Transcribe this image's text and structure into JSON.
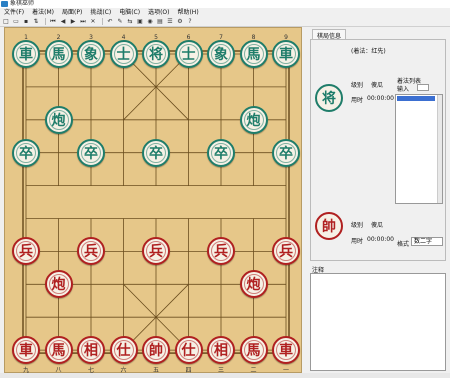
{
  "window": {
    "title": "象棋巫师"
  },
  "menu": [
    "文件(F)",
    "着法(M)",
    "局面(P)",
    "挑战(C)",
    "电脑(C)",
    "选项(O)",
    "帮助(H)"
  ],
  "toolbar_icons": [
    "new-file-icon",
    "open-file-icon",
    "save-file-icon",
    "flip-icon",
    "first-move-icon",
    "prev-move-icon",
    "next-move-icon",
    "last-move-icon",
    "delete-icon",
    "undo-icon",
    "edit-icon",
    "move-icon",
    "computer-icon",
    "analyze-icon",
    "book-icon",
    "options-icon",
    "settings-icon",
    "help-icon"
  ],
  "board": {
    "top_coords": [
      "1",
      "2",
      "3",
      "4",
      "5",
      "6",
      "7",
      "8",
      "9"
    ],
    "bottom_coords": [
      "九",
      "八",
      "七",
      "六",
      "五",
      "四",
      "三",
      "二",
      "一"
    ],
    "colors": {
      "board": "#e6c789",
      "line": "#6b4e1f",
      "black": "#1f7d6a",
      "red": "#b02020"
    },
    "pieces": [
      {
        "side": "black",
        "char": "車",
        "col": 0,
        "row": 0
      },
      {
        "side": "black",
        "char": "馬",
        "col": 1,
        "row": 0
      },
      {
        "side": "black",
        "char": "象",
        "col": 2,
        "row": 0
      },
      {
        "side": "black",
        "char": "士",
        "col": 3,
        "row": 0
      },
      {
        "side": "black",
        "char": "将",
        "col": 4,
        "row": 0
      },
      {
        "side": "black",
        "char": "士",
        "col": 5,
        "row": 0
      },
      {
        "side": "black",
        "char": "象",
        "col": 6,
        "row": 0
      },
      {
        "side": "black",
        "char": "馬",
        "col": 7,
        "row": 0
      },
      {
        "side": "black",
        "char": "車",
        "col": 8,
        "row": 0
      },
      {
        "side": "black",
        "char": "炮",
        "col": 1,
        "row": 2
      },
      {
        "side": "black",
        "char": "炮",
        "col": 7,
        "row": 2
      },
      {
        "side": "black",
        "char": "卒",
        "col": 0,
        "row": 3
      },
      {
        "side": "black",
        "char": "卒",
        "col": 2,
        "row": 3
      },
      {
        "side": "black",
        "char": "卒",
        "col": 4,
        "row": 3
      },
      {
        "side": "black",
        "char": "卒",
        "col": 6,
        "row": 3
      },
      {
        "side": "black",
        "char": "卒",
        "col": 8,
        "row": 3
      },
      {
        "side": "red",
        "char": "兵",
        "col": 0,
        "row": 6
      },
      {
        "side": "red",
        "char": "兵",
        "col": 2,
        "row": 6
      },
      {
        "side": "red",
        "char": "兵",
        "col": 4,
        "row": 6
      },
      {
        "side": "red",
        "char": "兵",
        "col": 6,
        "row": 6
      },
      {
        "side": "red",
        "char": "兵",
        "col": 8,
        "row": 6
      },
      {
        "side": "red",
        "char": "炮",
        "col": 1,
        "row": 7
      },
      {
        "side": "red",
        "char": "炮",
        "col": 7,
        "row": 7
      },
      {
        "side": "red",
        "char": "車",
        "col": 0,
        "row": 9
      },
      {
        "side": "red",
        "char": "馬",
        "col": 1,
        "row": 9
      },
      {
        "side": "red",
        "char": "相",
        "col": 2,
        "row": 9
      },
      {
        "side": "red",
        "char": "仕",
        "col": 3,
        "row": 9
      },
      {
        "side": "red",
        "char": "帥",
        "col": 4,
        "row": 9
      },
      {
        "side": "red",
        "char": "仕",
        "col": 5,
        "row": 9
      },
      {
        "side": "red",
        "char": "相",
        "col": 6,
        "row": 9
      },
      {
        "side": "red",
        "char": "馬",
        "col": 7,
        "row": 9
      },
      {
        "side": "red",
        "char": "車",
        "col": 8,
        "row": 9
      }
    ]
  },
  "panel": {
    "tab_label": "棋局信息",
    "turn_text": "(着法：红先)",
    "black_piece": "将",
    "red_piece": "帥",
    "black_level_label": "级别",
    "black_level_value": "傻瓜",
    "black_time_label": "用时",
    "black_time_value": "00:00:00",
    "red_level_label": "级别",
    "red_level_value": "傻瓜",
    "red_time_label": "用时",
    "red_time_value": "00:00:00",
    "move_list_label": "着法列表",
    "input_label": "输入",
    "format_label": "格式",
    "format_value": "数二字",
    "notes_label": "注释"
  }
}
